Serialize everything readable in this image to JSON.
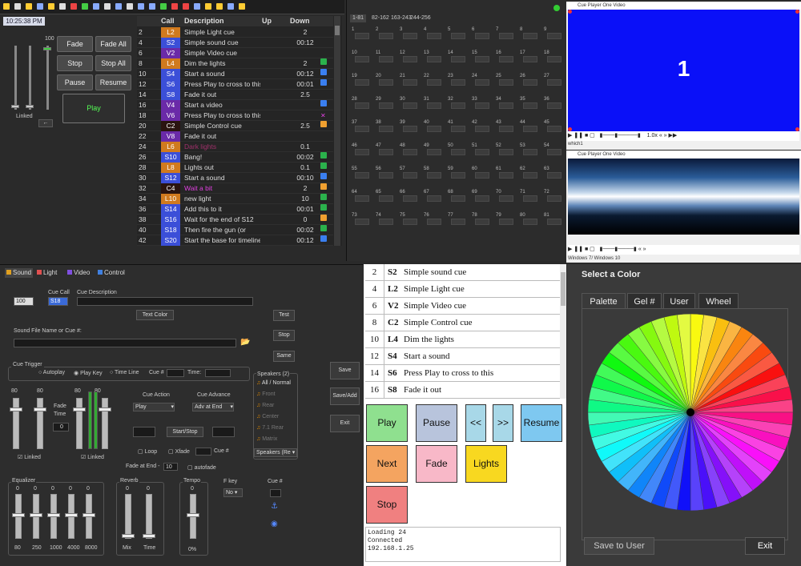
{
  "clock": "10:25:38 PM",
  "fade_panel": {
    "fade": "Fade",
    "fade_all": "Fade All",
    "stop": "Stop",
    "stop_all": "Stop All",
    "pause": "Pause",
    "resume": "Resume",
    "play": "Play",
    "level_label": "100",
    "linked": "Linked"
  },
  "cue_list": {
    "headers": {
      "call": "Call",
      "description": "Description",
      "up": "Up",
      "down": "Down"
    },
    "rows": [
      {
        "num": "2",
        "call": "L2",
        "color": "#d07a1e",
        "desc": "Simple Light cue",
        "down": "2",
        "icon": "",
        "desc_color": "#ddd"
      },
      {
        "num": "4",
        "call": "S2",
        "color": "#3b4fd8",
        "desc": "Simple sound cue",
        "down": "00:12",
        "icon": "",
        "desc_color": "#ddd"
      },
      {
        "num": "6",
        "call": "V2",
        "color": "#6a2aa8",
        "desc": "Simple Video cue",
        "down": "",
        "icon": "",
        "desc_color": "#ddd"
      },
      {
        "num": "8",
        "call": "L4",
        "color": "#d07a1e",
        "desc": "  Dim the lights",
        "down": "2",
        "icon": "green",
        "desc_color": "#ddd"
      },
      {
        "num": "10",
        "call": "S4",
        "color": "#3b4fd8",
        "desc": "Start a sound",
        "down": "00:12",
        "icon": "blue",
        "desc_color": "#ddd"
      },
      {
        "num": "12",
        "call": "S6",
        "color": "#3b4fd8",
        "desc": "Press Play to cross to this",
        "down": "00:01",
        "icon": "blue",
        "desc_color": "#ddd"
      },
      {
        "num": "14",
        "call": "S8",
        "color": "#3b4fd8",
        "desc": "Fade it out",
        "down": "2.5",
        "icon": "",
        "desc_color": "#ddd"
      },
      {
        "num": "16",
        "call": "V4",
        "color": "#6a2aa8",
        "desc": "Start a video",
        "down": "",
        "icon": "blue",
        "desc_color": "#ddd"
      },
      {
        "num": "18",
        "call": "V6",
        "color": "#6a2aa8",
        "desc": "Press Play to cross to this",
        "down": "",
        "icon": "x",
        "desc_color": "#ddd"
      },
      {
        "num": "20",
        "call": "C2",
        "color": "#2a1410",
        "desc": "Simple Control cue",
        "down": "2.5",
        "icon": "orange",
        "desc_color": "#ddd"
      },
      {
        "num": "22",
        "call": "V8",
        "color": "#6a2aa8",
        "desc": "Fade it out",
        "down": "",
        "icon": "",
        "desc_color": "#ddd"
      },
      {
        "num": "24",
        "call": "L6",
        "color": "#d07a1e",
        "desc": "Dark lights",
        "down": "0.1",
        "icon": "",
        "desc_color": "#a0306a"
      },
      {
        "num": "26",
        "call": "S10",
        "color": "#3b4fd8",
        "desc": "  Bang!",
        "down": "00:02",
        "icon": "green",
        "desc_color": "#ddd"
      },
      {
        "num": "28",
        "call": "L8",
        "color": "#d07a1e",
        "desc": "  Lights out",
        "down": "0.1",
        "icon": "green",
        "desc_color": "#ddd"
      },
      {
        "num": "30",
        "call": "S12",
        "color": "#3b4fd8",
        "desc": "Start  a sound",
        "down": "00:10",
        "icon": "blue",
        "desc_color": "#ddd"
      },
      {
        "num": "32",
        "call": "C4",
        "color": "#2a1410",
        "desc": "Wait a bit",
        "down": "2",
        "icon": "orange",
        "desc_color": "#e040e0"
      },
      {
        "num": "34",
        "call": "L10",
        "color": "#d07a1e",
        "desc": "new light",
        "down": "10",
        "icon": "green",
        "desc_color": "#ddd"
      },
      {
        "num": "36",
        "call": "S14",
        "color": "#3b4fd8",
        "desc": "  Add this to it",
        "down": "00:01",
        "icon": "green",
        "desc_color": "#ddd"
      },
      {
        "num": "38",
        "call": "S16",
        "color": "#3b4fd8",
        "desc": "Wait for the end of S12",
        "down": "0",
        "icon": "orange",
        "desc_color": "#ddd"
      },
      {
        "num": "40",
        "call": "S18",
        "color": "#3b4fd8",
        "desc": "  Then fire the gun (or",
        "down": "00:02",
        "icon": "green",
        "desc_color": "#ddd"
      },
      {
        "num": "42",
        "call": "S20",
        "color": "#3b4fd8",
        "desc": "Start the base for timeline",
        "down": "00:12",
        "icon": "blue",
        "desc_color": "#ddd"
      }
    ]
  },
  "grid": {
    "tabs": [
      "1-81",
      "82-162",
      "163-243",
      "244-256"
    ],
    "count": 81
  },
  "video1": {
    "title": "Cue Player One Video",
    "number": "1",
    "status": "which1",
    "speed": "1.0x"
  },
  "video2": {
    "title": "Cue Player One Video",
    "status": "Windows 7/ Windows 10"
  },
  "sound": {
    "tabs": [
      "Sound",
      "Light",
      "Video",
      "Control"
    ],
    "cue_call_label": "Cue Call",
    "cue_desc_label": "Cue Description",
    "cue_num": "100",
    "cue_call": "S18",
    "text_color": "Text Color",
    "test": "Test",
    "stop": "Stop",
    "same": "Same",
    "file_label": "Sound File Name or Cue #:",
    "trigger_label": "Cue Trigger",
    "autoplay": "Autoplay",
    "playkey": "Play Key",
    "timeline": "Time Line",
    "cue_hash": "Cue #",
    "time": "Time:",
    "speakers_label": "Speakers (2)",
    "speakers": [
      "All / Normal",
      "Front",
      "Rear",
      "Center",
      "7.1 Rear",
      "Matrix"
    ],
    "speakers_select": "Speakers (Re",
    "v80a": "80",
    "v80b": "80",
    "v80c": "80",
    "v80d": "80",
    "fade_time": "Fade Time",
    "fade_val": "0",
    "linked": "Linked",
    "cue_action": "Cue Action",
    "cue_action_val": "Play",
    "cue_advance": "Cue Advance",
    "cue_advance_val": "Adv at End",
    "start_stop": "Start/Stop",
    "loop": "Loop",
    "xfade": "Xfade",
    "cue_hash2": "Cue #",
    "fade_at_end": "Fade at End -",
    "fade_at_end_val": "10",
    "autofade": "autofade",
    "save": "Save",
    "save_add": "Save/Add",
    "exit": "Exit",
    "eq_label": "Equalizer",
    "eq_vals": [
      "0",
      "0",
      "0",
      "0",
      "0"
    ],
    "eq_freqs": [
      "80",
      "250",
      "1000",
      "4000",
      "8000"
    ],
    "reverb_label": "Reverb",
    "reverb_vals": [
      "0",
      "0"
    ],
    "reverb_names": [
      "Mix",
      "Time"
    ],
    "tempo_label": "Tempo",
    "tempo_val": "0",
    "tempo_pct": "0%",
    "fkey_label": "F key",
    "fkey_val": "No",
    "cue_hash3": "Cue #"
  },
  "remote": {
    "rows": [
      {
        "num": "2",
        "call": "S2",
        "desc": "Simple sound cue"
      },
      {
        "num": "4",
        "call": "L2",
        "desc": "Simple Light cue"
      },
      {
        "num": "6",
        "call": "V2",
        "desc": "Simple Video cue"
      },
      {
        "num": "8",
        "call": "C2",
        "desc": "Simple Control cue"
      },
      {
        "num": "10",
        "call": "L4",
        "desc": "Dim the lights"
      },
      {
        "num": "12",
        "call": "S4",
        "desc": "Start a sound"
      },
      {
        "num": "14",
        "call": "S6",
        "desc": "Press Play to cross to this"
      },
      {
        "num": "16",
        "call": "S8",
        "desc": "Fade it out"
      }
    ],
    "play": "Play",
    "pause": "Pause",
    "back": "<<",
    "fwd": ">>",
    "resume": "Resume",
    "next": "Next",
    "fade": "Fade",
    "lights": "Lights",
    "stop": "Stop",
    "log": [
      "Loading 24",
      "Connected",
      "192.168.1.25"
    ],
    "colors": {
      "play": "#8fe08f",
      "pause": "#b8c4dc",
      "nav": "#a8d8e8",
      "resume": "#7ec8f0",
      "next": "#f4a460",
      "fade": "#f8b8c8",
      "lights": "#f8d820",
      "stop": "#f08080"
    }
  },
  "color_panel": {
    "title": "Select a Color",
    "tabs": [
      "Palette",
      "Gel #",
      "User",
      "Wheel"
    ],
    "save_user": "Save to User",
    "exit": "Exit"
  }
}
